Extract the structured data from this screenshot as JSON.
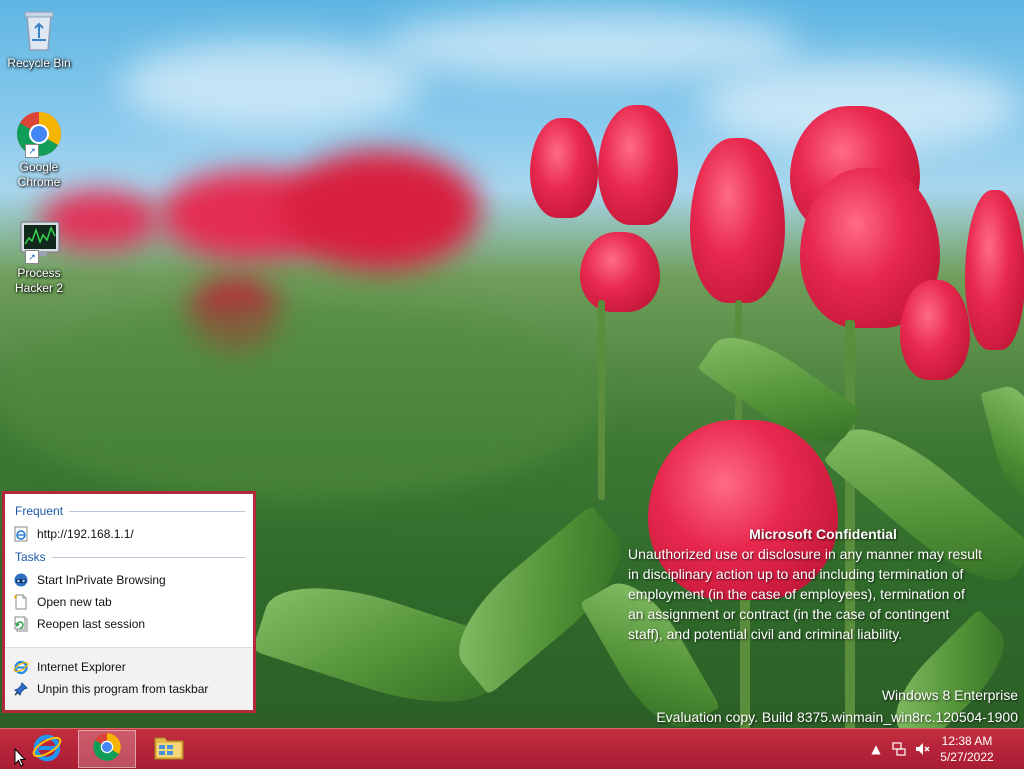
{
  "desktop_icons": [
    {
      "label": "Recycle Bin",
      "icon": "recycle-bin-icon"
    },
    {
      "label": "Google Chrome",
      "icon": "chrome-icon"
    },
    {
      "label": "Process Hacker 2",
      "icon": "process-hacker-icon"
    }
  ],
  "watermark": {
    "title": "Microsoft Confidential",
    "lines": [
      "Unauthorized use or disclosure in any manner may result",
      "in disciplinary action up to and including termination of",
      "employment (in the case of employees), termination of",
      "an assignment or contract (in the case of contingent",
      "staff), and potential civil and criminal liability."
    ]
  },
  "version": {
    "edition": "Windows 8 Enterprise",
    "build": "Evaluation copy. Build 8375.winmain_win8rc.120504-1900"
  },
  "jumplist": {
    "frequent_header": "Frequent",
    "frequent_items": [
      {
        "label": "http://192.168.1.1/",
        "icon": "ie-page-icon"
      }
    ],
    "tasks_header": "Tasks",
    "task_items": [
      {
        "label": "Start InPrivate Browsing",
        "icon": "inprivate-icon"
      },
      {
        "label": "Open new tab",
        "icon": "new-tab-icon"
      },
      {
        "label": "Reopen last session",
        "icon": "reopen-session-icon"
      }
    ],
    "bottom_items": [
      {
        "label": "Internet Explorer",
        "icon": "internet-explorer-icon"
      },
      {
        "label": "Unpin this program from taskbar",
        "icon": "unpin-icon"
      }
    ]
  },
  "taskbar": {
    "pinned": [
      {
        "name": "Internet Explorer",
        "icon": "internet-explorer-icon"
      },
      {
        "name": "Google Chrome",
        "icon": "chrome-icon",
        "active": true
      },
      {
        "name": "File Explorer",
        "icon": "file-explorer-icon"
      }
    ],
    "tray_icons": [
      "show-hidden-icons-icon",
      "network-icon",
      "volume-muted-icon"
    ],
    "clock": {
      "time": "12:38 AM",
      "date": "5/27/2022"
    }
  },
  "colors": {
    "taskbar": "#b6243a",
    "jumplist_border": "#b22a3a",
    "accent_text": "#1e5aa8"
  }
}
